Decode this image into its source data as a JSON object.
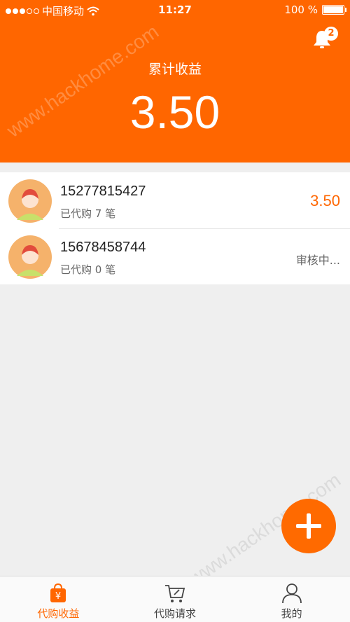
{
  "status_bar": {
    "carrier": "中国移动",
    "time": "11:27",
    "battery": "100 %"
  },
  "header": {
    "notifications_badge": "2",
    "cumulative_label": "累计收益",
    "cumulative_value": "3.50"
  },
  "list": {
    "items": [
      {
        "phone": "15277815427",
        "count": "已代购 7 笔",
        "amount": "3.50"
      },
      {
        "phone": "15678458744",
        "count": "已代购 0 笔",
        "status": "审核中..."
      }
    ]
  },
  "tabbar": {
    "tabs": [
      {
        "label": "代购收益",
        "icon": "shopping-bag-yen-icon",
        "active": true
      },
      {
        "label": "代购请求",
        "icon": "cart-icon",
        "active": false
      },
      {
        "label": "我的",
        "icon": "user-icon",
        "active": false
      }
    ]
  },
  "watermarks": [
    "www.hackhome.com",
    "www.hackhome.com"
  ],
  "colors": {
    "accent": "#ff6600",
    "background": "#efefef"
  }
}
